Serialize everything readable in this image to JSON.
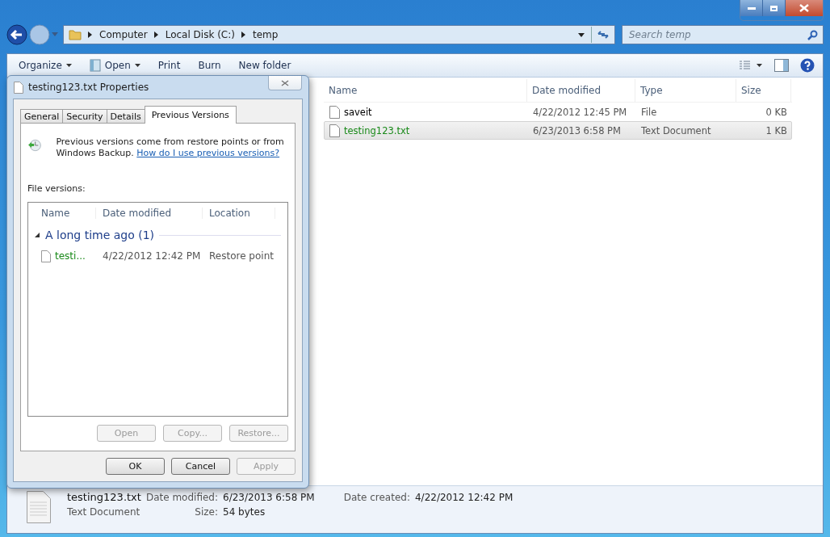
{
  "explorer": {
    "breadcrumb": [
      "Computer",
      "Local Disk (C:)",
      "temp"
    ],
    "search": {
      "placeholder": "Search temp"
    },
    "toolbar": [
      {
        "label": "Organize",
        "dropdown": true,
        "kind": "plain"
      },
      {
        "label": "Open",
        "dropdown": true,
        "kind": "icon"
      },
      {
        "label": "Print",
        "dropdown": false,
        "kind": "plain"
      },
      {
        "label": "Burn",
        "dropdown": false,
        "kind": "plain"
      },
      {
        "label": "New folder",
        "dropdown": false,
        "kind": "plain"
      }
    ],
    "columns": [
      "Name",
      "Date modified",
      "Type",
      "Size"
    ],
    "rows": [
      {
        "name": "saveit",
        "date": "4/22/2012 12:45 PM",
        "type": "File",
        "size": "0 KB",
        "selected": false,
        "color": "#000000"
      },
      {
        "name": "testing123.txt",
        "date": "6/23/2013 6:58 PM",
        "type": "Text Document",
        "size": "1 KB",
        "selected": true,
        "color": "#1a8a1a"
      }
    ],
    "details": {
      "name": "testing123.txt",
      "type": "Text Document",
      "fields": [
        {
          "label": "Date modified:",
          "value": "6/23/2013 6:58 PM"
        },
        {
          "label": "Size:",
          "value": "54 bytes"
        },
        {
          "label": "Date created:",
          "value": "4/22/2012 12:42 PM"
        }
      ]
    }
  },
  "dialog": {
    "title": "testing123.txt Properties",
    "tabs": [
      {
        "label": "General",
        "selected": false
      },
      {
        "label": "Security",
        "selected": false
      },
      {
        "label": "Details",
        "selected": false
      },
      {
        "label": "Previous Versions",
        "selected": true
      }
    ],
    "info": "Previous versions come from restore points or from Windows Backup.",
    "link": "How do I use previous versions?",
    "versions_label": "File versions:",
    "columns": [
      "Name",
      "Date modified",
      "Location"
    ],
    "group": {
      "label": "A long time ago (1)",
      "expanded": true
    },
    "versions": [
      {
        "name": "testi...",
        "date": "4/22/2012 12:42 PM",
        "location": "Restore point",
        "color": "#1a8a1a"
      }
    ],
    "actions": [
      {
        "label": "Open",
        "disabled": true
      },
      {
        "label": "Copy...",
        "disabled": true
      },
      {
        "label": "Restore...",
        "disabled": true
      }
    ],
    "buttons": [
      {
        "label": "OK",
        "disabled": false
      },
      {
        "label": "Cancel",
        "disabled": false
      },
      {
        "label": "Apply",
        "disabled": true
      }
    ]
  }
}
